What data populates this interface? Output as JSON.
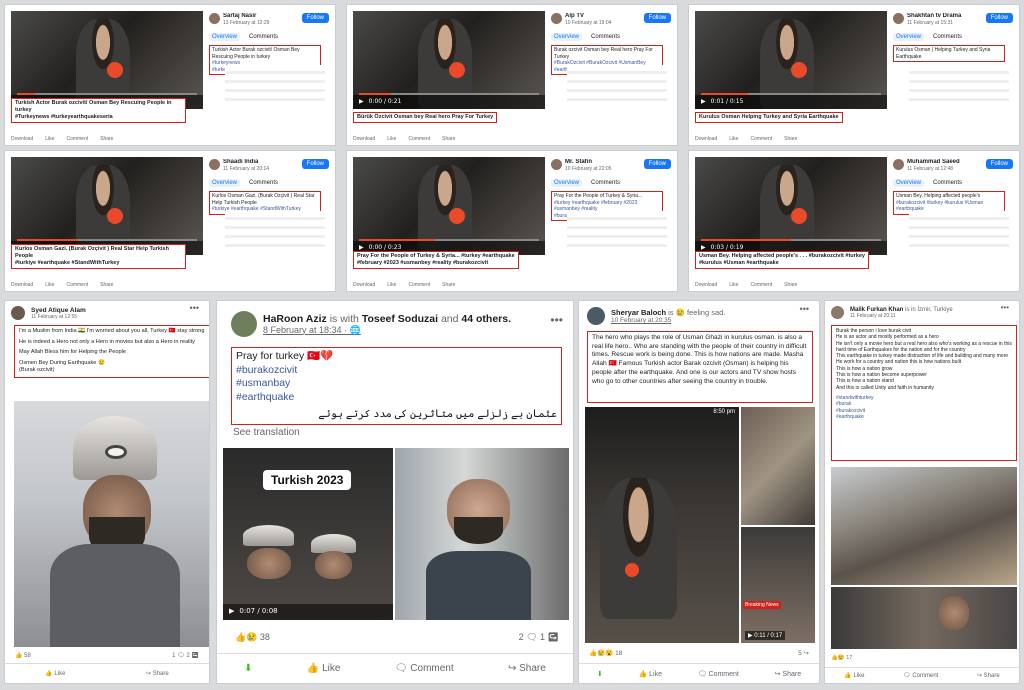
{
  "panels": [
    {
      "author": "Sartaj Nasir",
      "date": "13 February at 12:29",
      "follow": "Follow",
      "tabs": [
        "Overview",
        "Comments"
      ],
      "sidebox": [
        "Turkish Actor Burak ozcivit/ Osman Bey Rescuing People in turkey",
        "#turkeynews",
        "#turkeyearthquakeseria"
      ],
      "caption": [
        "Turkish Actor Burak ozcivit/ Osman Bey Rescuing People in turkey",
        "#Turkeynews #turkeyearthquakeseria"
      ],
      "actions": [
        "Download",
        "Like",
        "Comment",
        "Share"
      ],
      "time": "0:02 / 0:20"
    },
    {
      "author": "Alp TV",
      "date": "10 February at 19:04",
      "follow": "Follow",
      "tabs": [
        "Overview",
        "Comments"
      ],
      "sidebox": [
        "Burak ozcivit Osman bey Real hero Pray For Turkey",
        "#BurakOzcivit #BurakOzcivit #UsmanBey",
        "#earthquake #Turkey"
      ],
      "caption": [
        "Bürük Özcivit Osman bey Real hero Pray For Turkey"
      ],
      "actions": [
        "Download",
        "Like",
        "Comment",
        "Share"
      ],
      "time": "0:00 / 0:21"
    },
    {
      "author": "Shakhtan tv Drama",
      "date": "11 February at 15:31",
      "follow": "Follow",
      "tabs": [
        "Overview",
        "Comments"
      ],
      "sidebox": [
        "Kurulus Osman | Helping Turkey and Syria Earthquake"
      ],
      "caption": [
        "Kurulus Osman Helping Turkey and Syria Earthquake"
      ],
      "actions": [
        "Download",
        "Like",
        "Comment",
        "Share"
      ],
      "time": "0:01 / 0:15"
    },
    {
      "author": "Shaadi India",
      "date": "11 February at 20:14",
      "follow": "Follow",
      "tabs": [
        "Overview",
        "Comments"
      ],
      "sidebox": [
        "Kurlos Osman Gazi. (Burak Ozçivit ) Real Star Help Turkish People",
        "#turkiye #earthquake #StandWithTurkey"
      ],
      "caption": [
        "Kurlos Osman Gazi. (Burak Ozçivit ) Real Star Help Turkish People",
        "#turkiye #earthquake #StandWithTurkey"
      ],
      "actions": [
        "Download",
        "Like",
        "Comment",
        "Share"
      ],
      "time": "0:14 / 0:40"
    },
    {
      "author": "Mr. Stafin",
      "date": "10 February at 22:05",
      "follow": "Follow",
      "tabs": [
        "Overview",
        "Comments"
      ],
      "sidebox": [
        "Pray For the People of Turkey & Syria...",
        "#turkey #earthquake #february #2023",
        "#usmanbey #reality",
        "#burakozcivit"
      ],
      "caption": [
        "Pray For the People of Turkey & Syria... #turkey #earthquake",
        "#february #2023 #usmanbey #reality #burakozcivit"
      ],
      "actions": [
        "Download",
        "Like",
        "Comment",
        "Share"
      ],
      "time": "0:00 / 0:23"
    },
    {
      "author": "Muhammad Saeed",
      "date": "11 February at 12:48",
      "follow": "Follow",
      "tabs": [
        "Overview",
        "Comments"
      ],
      "sidebox": [
        "Usman Bey. Helping affected people's",
        "#burakozcivit #turkey #kurulus #Usman #earthquake"
      ],
      "caption": [
        "Usman Bey. Helping affected people's . . . #burakozcivit #turkey",
        "#kurulus #Usman #earthquake"
      ],
      "actions": [
        "Download",
        "Like",
        "Comment",
        "Share"
      ],
      "time": "0:03 / 0:19"
    }
  ],
  "post1": {
    "author": "Syed Atique Alam",
    "date": "11 February at 12:55",
    "text": [
      "I'm a Muslim from India 🇮🇳 I'm worried about you all, Turkey 🇹🇷 stay strong",
      "He is indeed a Hero not only a Hero in movies but also a Hero in reality",
      "May Allah Bless him for Helping the People",
      "Osmen Bey During Earthquake 😢",
      "(Burak ozcivit)"
    ],
    "reactions": "58",
    "comments": "1",
    "shares": "2",
    "like": "Like",
    "share": "Share"
  },
  "post2": {
    "author": "HaRoon Aziz",
    "with": "is with",
    "tagged": "Toseef Soduzai",
    "and": "and",
    "others": "44 others.",
    "date": "8 February at 18:34",
    "line1": "Pray for turkey 🇹🇷💔",
    "tags": [
      "#burakozcivit",
      "#usmanbay",
      "#earthquake"
    ],
    "urdu": "عثمان بے زلزلے میں متاثرین کی مدد کرتے ہوئے",
    "translate": "See translation",
    "video_label": "Turkish 2023",
    "video_time": "0:07 / 0:08",
    "reactions": "38",
    "comments": "2",
    "shares": "1",
    "like": "Like",
    "comment": "Comment",
    "share": "Share"
  },
  "post3": {
    "author": "Sheryar Baloch",
    "feeling": "is 😢 feeling sad.",
    "date": "10 February at 20:35",
    "text": "The hero who plays the role of Usman Ghazi in kurulus osman. is also a real life hero.. Who are standing with the people of their country in difficult times. Rescue work is being done. This is how nations are made. Masha Allah 🇹🇷 Famous Turkish actor Barak ozcivit (Osman) is helping his people after the earthquake. And one is our actors and TV show hosts who go to other countries after seeing the country in trouble.",
    "phone_time": "8:50 pm",
    "badge": "Breaking News",
    "video_time": "0:11 / 0:17",
    "reactions": "18",
    "shares": "5",
    "like": "Like",
    "comment": "Comment",
    "share": "Share"
  },
  "post4": {
    "author": "Malik Furkan Khan",
    "location": "is in İzmir, Turkiye",
    "date": "11 February at 20:11",
    "text": [
      "Burak the person i love burak civit",
      "He is an actor and mostly performed as a hero",
      "He isn't only a movie hero but a real hero also who's working as a rescue in this hard time of Earthquakes for the nation and for the country",
      "This earthquake in turkey made distraction of life and building and many more",
      "He work for a country and nation this is how nations built",
      "This is how a nation grow",
      "This is how a nation become superpower",
      "This is how a nation stand",
      "And this is called Unity and faith in humanity"
    ],
    "tags": [
      "#standwithturkey",
      "#burak",
      "#burakozcivit",
      "#earthquake"
    ],
    "reactions": "17",
    "like": "Like",
    "comment": "Comment",
    "share": "Share"
  }
}
